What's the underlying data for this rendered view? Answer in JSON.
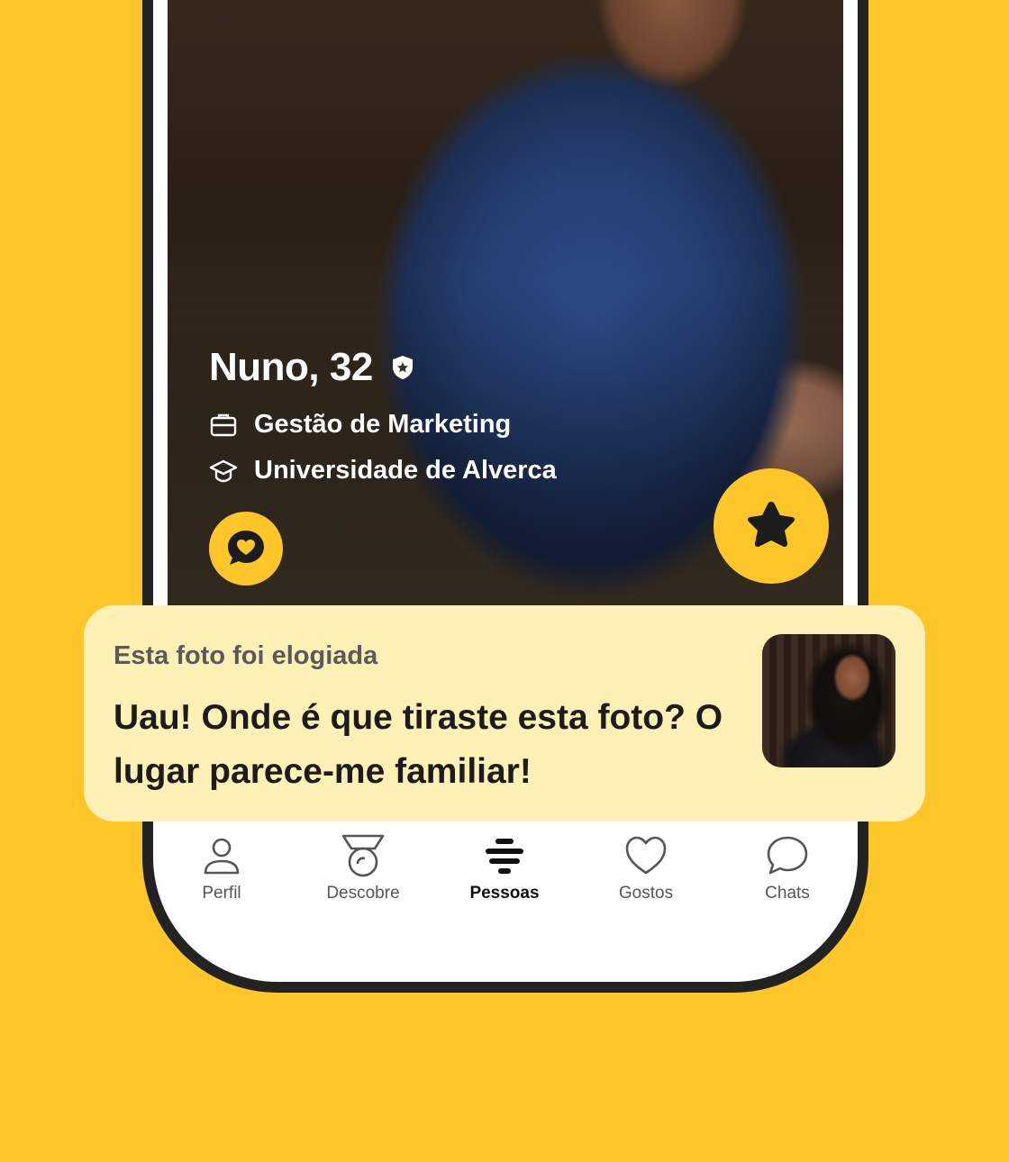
{
  "profile": {
    "name_age": "Nuno, 32",
    "job": "Gestão de Marketing",
    "school": "Universidade de Alverca"
  },
  "compliment": {
    "subtitle": "Esta foto foi elogiada",
    "message": "Uau! Onde é que tiraste esta foto? O lugar parece-me familiar!"
  },
  "tabs": [
    {
      "label": "Perfil",
      "icon": "person-icon"
    },
    {
      "label": "Descobre",
      "icon": "medal-icon"
    },
    {
      "label": "Pessoas",
      "icon": "people-stack-icon",
      "active": true
    },
    {
      "label": "Gostos",
      "icon": "heart-icon"
    },
    {
      "label": "Chats",
      "icon": "chat-bubble-icon"
    }
  ],
  "colors": {
    "brand_yellow": "#FFC629",
    "card_background": "#FFF1B5",
    "phone_frame": "#232323"
  }
}
